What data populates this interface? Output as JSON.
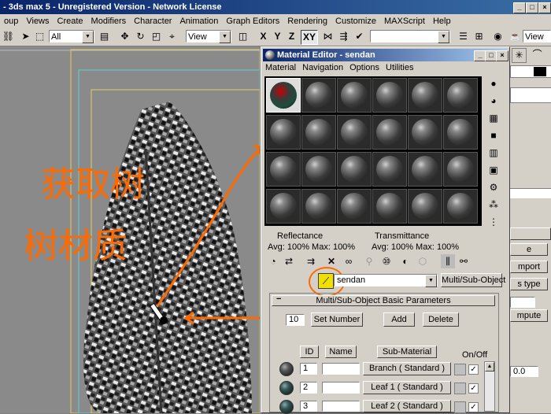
{
  "window": {
    "title": "- 3ds max 5 - Unregistered Version - Network License"
  },
  "menu": [
    "oup",
    "Views",
    "Create",
    "Modifiers",
    "Character",
    "Animation",
    "Graph Editors",
    "Rendering",
    "Customize",
    "MAXScript",
    "Help"
  ],
  "toolbar": {
    "selection_filter": "All",
    "ref_coord": "View",
    "axis_x": "X",
    "axis_y": "Y",
    "axis_z": "Z",
    "axis_xy": "XY"
  },
  "command_panel": {
    "import_label": "mport",
    "type_label": "s type",
    "compute_label": "mpute",
    "value": "0.0"
  },
  "material_editor": {
    "title": "Material Editor - sendan",
    "menu": [
      "Material",
      "Navigation",
      "Options",
      "Utilities"
    ],
    "reflectance_label": "Reflectance",
    "reflectance_values": "Avg: 100% Max: 100%",
    "transmittance_label": "Transmittance",
    "transmittance_values": "Avg: 100% Max: 100%",
    "material_name": "sendan",
    "material_type": "Multi/Sub-Object",
    "rollout_title": "Multi/Sub-Object Basic Parameters",
    "count": "10",
    "set_number": "Set Number",
    "add": "Add",
    "delete": "Delete",
    "col_id": "ID",
    "col_name": "Name",
    "col_submaterial": "Sub-Material",
    "col_onoff": "On/Off",
    "rows": [
      {
        "id": "1",
        "name": "",
        "material": "Branch  ( Standard )",
        "on": true
      },
      {
        "id": "2",
        "name": "",
        "material": "Leaf 1  ( Standard )",
        "on": true
      },
      {
        "id": "3",
        "name": "",
        "material": "Leaf 2  ( Standard )",
        "on": true
      }
    ]
  },
  "annotations": {
    "line1": "获取树",
    "line2": "树材质",
    "color": "#ff6a00"
  }
}
